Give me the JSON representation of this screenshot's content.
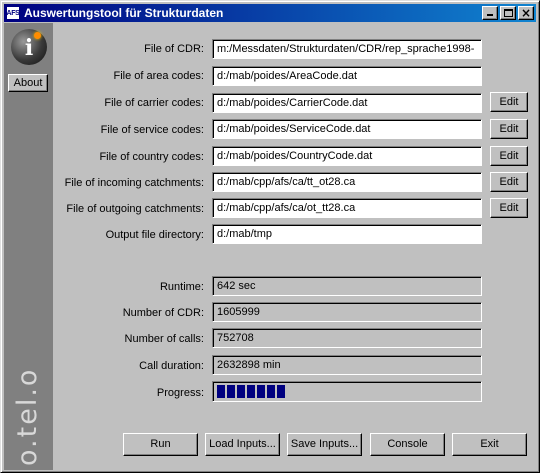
{
  "window": {
    "icon_text": "AFS",
    "title": "Auswertungstool für Strukturdaten"
  },
  "sidebar": {
    "about_label": "About",
    "brand_text": "o.tel.o"
  },
  "inputs": [
    {
      "label": "File of CDR:",
      "value": "m:/Messdaten/Strukturdaten/CDR/rep_sprache1998-",
      "edit": false
    },
    {
      "label": "File of area codes:",
      "value": "d:/mab/poides/AreaCode.dat",
      "edit": false
    },
    {
      "label": "File of carrier codes:",
      "value": "d:/mab/poides/CarrierCode.dat",
      "edit": true
    },
    {
      "label": "File of service codes:",
      "value": "d:/mab/poides/ServiceCode.dat",
      "edit": true
    },
    {
      "label": "File of country codes:",
      "value": "d:/mab/poides/CountryCode.dat",
      "edit": true
    },
    {
      "label": "File of incoming catchments:",
      "value": "d:/mab/cpp/afs/ca/tt_ot28.ca",
      "edit": true
    },
    {
      "label": "File of outgoing catchments:",
      "value": "d:/mab/cpp/afs/ca/ot_tt28.ca",
      "edit": true
    },
    {
      "label": "Output file directory:",
      "value": "d:/mab/tmp",
      "edit": false
    }
  ],
  "edit_label": "Edit",
  "stats": [
    {
      "label": "Runtime:",
      "value": "642 sec"
    },
    {
      "label": "Number of CDR:",
      "value": "1605999"
    },
    {
      "label": "Number of calls:",
      "value": "752708"
    },
    {
      "label": "Call duration:",
      "value": "2632898 min"
    }
  ],
  "progress": {
    "label": "Progress:",
    "fraction": 0.27,
    "color": "#000080"
  },
  "buttons": {
    "run": "Run",
    "load": "Load Inputs...",
    "save": "Save Inputs...",
    "console": "Console",
    "exit": "Exit"
  }
}
